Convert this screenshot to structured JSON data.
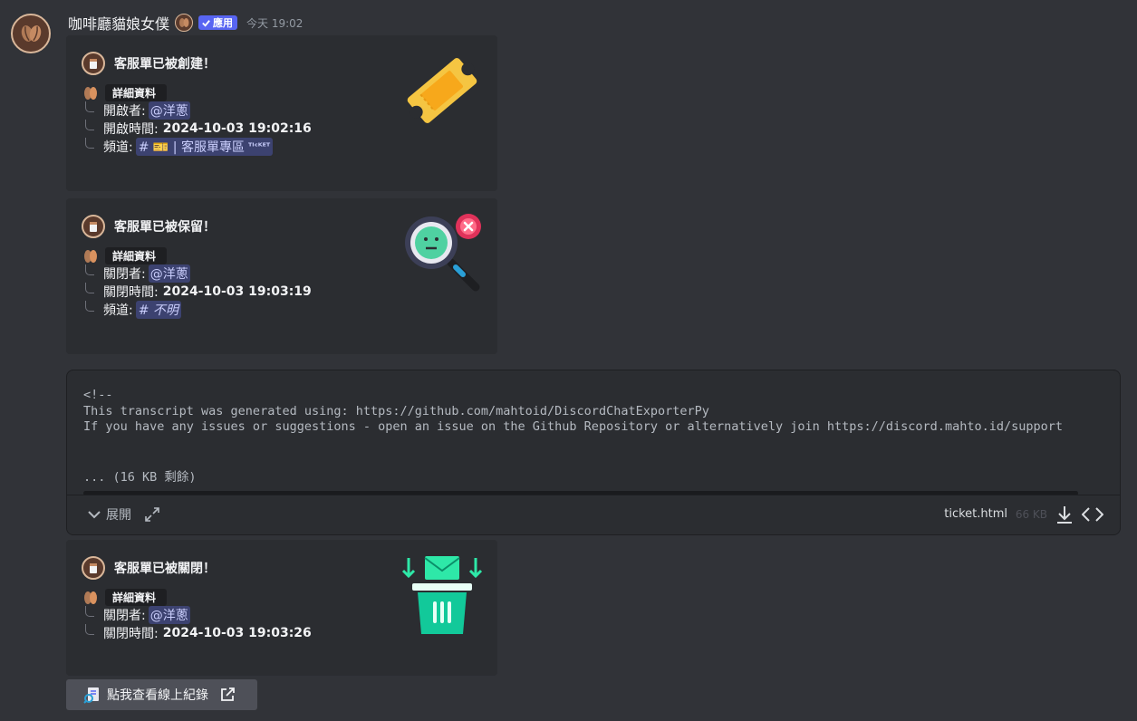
{
  "message": {
    "username": "咖啡廳貓娘女僕",
    "app_badge": "應用",
    "timestamp": "今天 19:02"
  },
  "embeds": [
    {
      "title": "客服單已被創建！",
      "details_label": "詳細資料",
      "fields": [
        {
          "label": "開啟者:",
          "mention": "@洋蔥"
        },
        {
          "label": "開啟時間:",
          "value": "2024-10-03 19:02:16"
        },
        {
          "label": "頻道:",
          "channel": "# 🎫 | 客服單專區",
          "channel_suffix": "ᵀᴵᶜᴷᴱᵀ"
        }
      ],
      "thumbnail_icon": "ticket-icon"
    },
    {
      "title": "客服單已被保留！",
      "details_label": "詳細資料",
      "fields": [
        {
          "label": "關閉者:",
          "mention": "@洋蔥"
        },
        {
          "label": "關閉時間:",
          "value": "2024-10-03 19:03:19"
        },
        {
          "label": "頻道:",
          "channel": "# 不明"
        }
      ],
      "thumbnail_icon": "magnifier-not-found-icon"
    },
    {
      "title": "客服單已被關閉！",
      "details_label": "詳細資料",
      "fields": [
        {
          "label": "關閉者:",
          "mention": "@洋蔥"
        },
        {
          "label": "關閉時間:",
          "value": "2024-10-03 19:03:26"
        }
      ],
      "thumbnail_icon": "mail-trash-icon"
    }
  ],
  "file": {
    "code_lines": [
      "<!--",
      "This transcript was generated using: https://github.com/mahtoid/DiscordChatExporterPy",
      "If you have any issues or suggestions - open an issue on the Github Repository or alternatively join https://discord.mahto.id/support"
    ],
    "more_text": "... (16 KB 剩餘)",
    "expand_label": "展開",
    "file_name": "ticket.html",
    "file_size": "66 KB"
  },
  "link_button": {
    "label": "點我查看線上紀錄"
  },
  "colors": {
    "background": "#313338",
    "embed_bg": "#2b2d31",
    "mention_bg": "#3c4270",
    "badge": "#5865f2"
  }
}
